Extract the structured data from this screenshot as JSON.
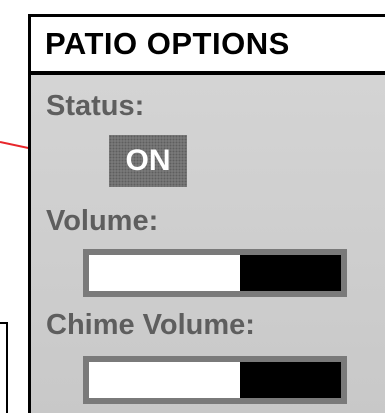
{
  "panel": {
    "title": "PATIO OPTIONS"
  },
  "status": {
    "label": "Status:",
    "toggle_value": "ON"
  },
  "volume": {
    "label": "Volume:",
    "level": 0.6
  },
  "chime_volume": {
    "label": "Chime Volume:",
    "level": 0.6
  },
  "colors": {
    "arrow": "#e8262b",
    "panel_bg": "#d0d0d0",
    "label_text": "#5e5e5e",
    "toggle_bg": "#7d7d7d",
    "slider_frame": "#7a7a7a",
    "slider_filled": "#ffffff",
    "slider_empty": "#000000"
  }
}
